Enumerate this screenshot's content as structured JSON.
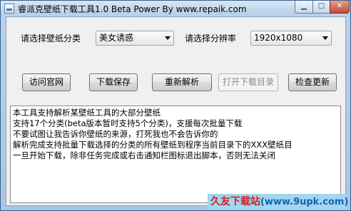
{
  "window": {
    "title": "睿派克壁纸下载工具1.0 Beta Power By www.repaik.com"
  },
  "controls": {
    "category_label": "请选择壁纸分类",
    "category_value": "美女诱惑",
    "resolution_label": "请选择分辨率",
    "resolution_value": "1920x1080"
  },
  "buttons": {
    "visit_site": "访问官网",
    "download_save": "下载保存",
    "reparse": "重新解析",
    "open_dir": "打开下载目录",
    "check_update": "检查更新"
  },
  "log": {
    "lines": [
      "本工具支持解析某壁纸工具的大部分壁纸",
      "支持17个分类(beta版本暂时支持5个分类)，支援每次批量下载",
      "不要试图让我告诉你壁纸的来源，打死我也不会告诉你的",
      "解析完成支持批量下载选择的分类的所有壁纸到程序当前目录下的XXX壁纸目",
      "一旦开始下载，除非任务完成或右击通知栏图标退出脚本，否则无法关闭"
    ]
  },
  "watermark": {
    "name": "久友下载站",
    "url": "(www.9upk.com)"
  }
}
